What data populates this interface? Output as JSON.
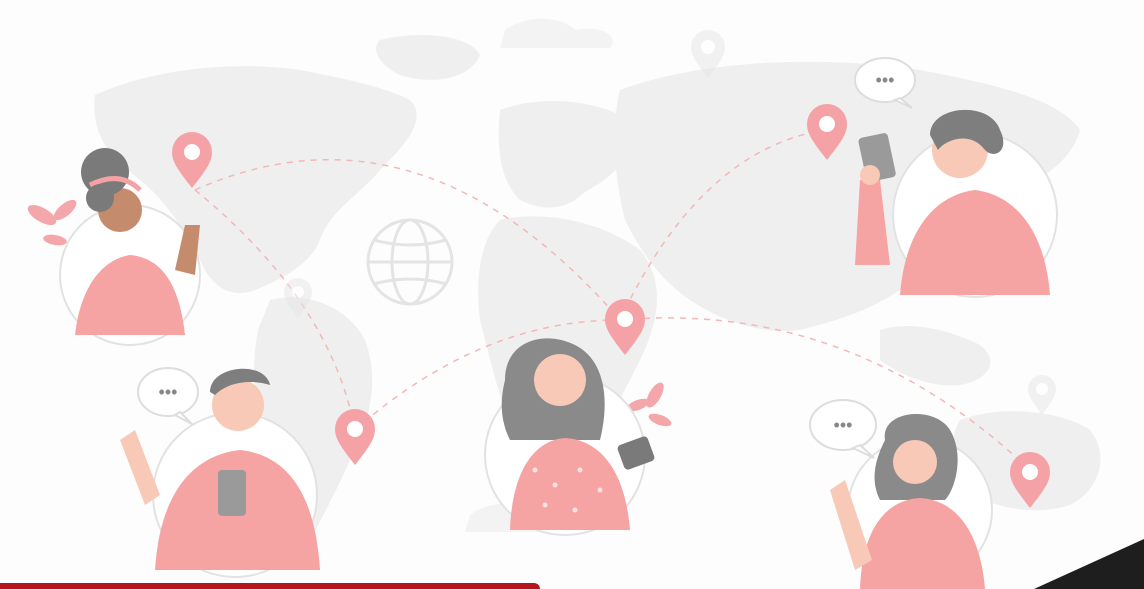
{
  "illustration": {
    "description_icons": [
      "world-map",
      "location-pin",
      "chat-bubble",
      "globe-icon",
      "smartphone"
    ],
    "people_count": 5,
    "colors": {
      "accent_pink": "#f0a7a7",
      "pin_pink": "#f4a2a6",
      "skin": "#f7c9b6",
      "shirt": "#f5a3a3",
      "map": "#efefef",
      "hair_gray": "#8a8a8a",
      "bar_red": "#b3161c",
      "corner_dark": "#1e1e1e"
    },
    "chat_bubbles": [
      {
        "text": "•••"
      },
      {
        "text": "•••"
      },
      {
        "text": "•••"
      }
    ]
  }
}
